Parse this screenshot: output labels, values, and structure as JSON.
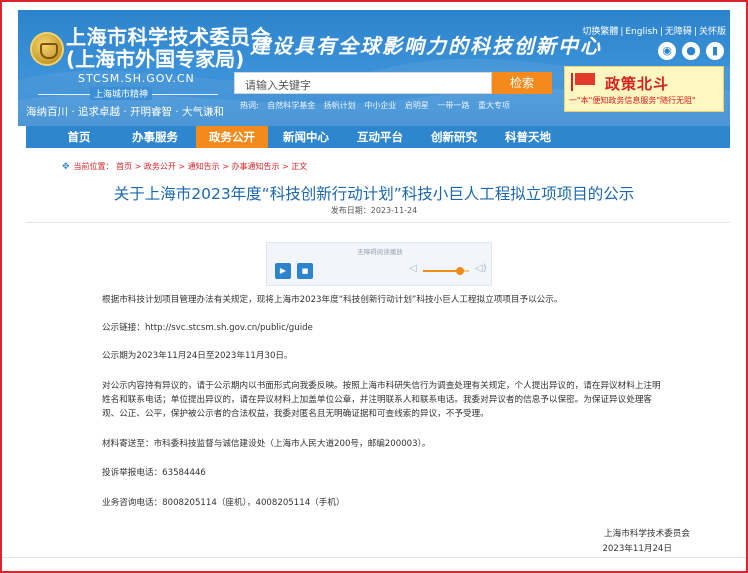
{
  "header": {
    "org_name_cn": "上海市科学技术委员会",
    "org_name_sub": "(上海市外国专家局)",
    "domain": "STCSM.SH.GOV.CN",
    "spirit_title": "上海城市精神",
    "spirit": "海纳百川 · 追求卓越 · 开明睿智 · 大气谦和",
    "slogan": "建设具有全球影响力的科技创新中心",
    "top_links": [
      "切换繁體",
      "English",
      "无障碍",
      "关怀版"
    ],
    "social_icons": [
      "weibo-icon",
      "wechat-icon",
      "app-icon"
    ],
    "search": {
      "placeholder": "请输入关键字",
      "button": "检索"
    },
    "hot_label": "热词:",
    "hot_words": [
      "自然科学基金",
      "扬帆计划",
      "中小企业",
      "启明星",
      "一带一路",
      "重大专项"
    ],
    "banner": {
      "title": "政策北斗",
      "subtitle": "一\"本\"便知政务信息服务\"随行无阻\""
    }
  },
  "nav": {
    "items": [
      {
        "label": "首页",
        "active": false
      },
      {
        "label": "办事服务",
        "active": false
      },
      {
        "label": "政务公开",
        "active": true
      },
      {
        "label": "新闻中心",
        "active": false
      },
      {
        "label": "互动平台",
        "active": false
      },
      {
        "label": "创新研究",
        "active": false
      },
      {
        "label": "科普天地",
        "active": false
      }
    ]
  },
  "breadcrumb": "当前位置： 首页 > 政务公开 > 通知告示 > 办事通知告示 > 正文",
  "article": {
    "title": "关于上海市2023年度“科技创新行动计划”科技小巨人工程拟立项项目的公示",
    "pub_date": "发布日期：2023-11-24",
    "player_title": "无障碍阅读播放",
    "player_volume_fraction": 0.8,
    "paragraphs": [
      "根据市科技计划项目管理办法有关规定，现将上海市2023年度“科技创新行动计划”科技小巨人工程拟立项项目予以公示。",
      "公示链接：http://svc.stcsm.sh.gov.cn/public/guide",
      "公示期为2023年11月24日至2023年11月30日。",
      "对公示内容持有异议的，请于公示期内以书面形式向我委反映。按照上海市科研失信行为调查处理有关规定，个人提出异议的，请在异议材料上注明姓名和联系电话；单位提出异议的，请在异议材料上加盖单位公章，并注明联系人和联系电话。我委对异议者的信息予以保密。为保证异议处理客观、公正、公平，保护被公示者的合法权益，我委对匿名且无明确证据和可查线索的异议，不予受理。",
      "材料寄送至：市科委科技监督与诚信建设处（上海市人民大道200号，邮编200003）。",
      "投诉举报电话：63584446",
      "业务咨询电话：8008205114（座机），4008205114（手机）"
    ],
    "signature_org": "上海市科学技术委员会",
    "signature_date": "2023年11月24日"
  }
}
